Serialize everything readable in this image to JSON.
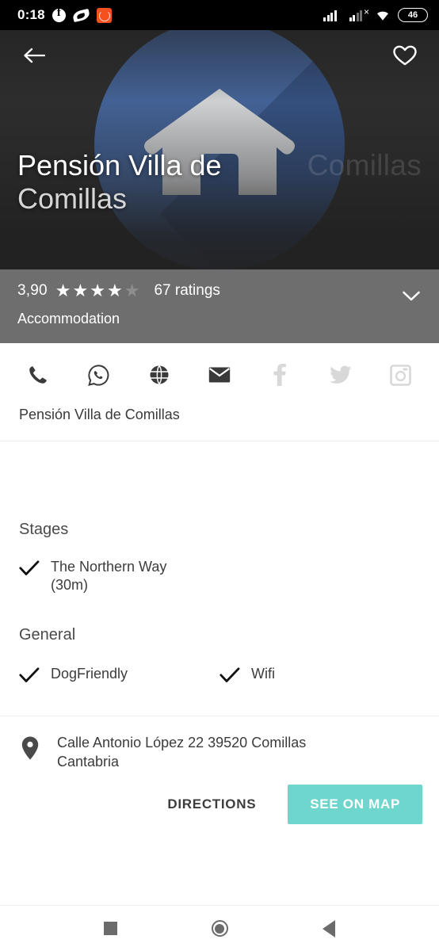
{
  "status_bar": {
    "time": "0:18",
    "battery_percent": "46",
    "icons": [
      "facebook-icon",
      "leaf-icon",
      "orange-app-icon",
      "signal-bars-icon",
      "signal-no-sim-icon",
      "wifi-icon",
      "battery-icon"
    ]
  },
  "hero": {
    "back_icon": "back-arrow-icon",
    "favorite_icon": "heart-outline-icon",
    "title_line1": "Pensión Villa de",
    "title_line2": "Comillas",
    "ghost_text": "Comillas",
    "placeholder_icon": "house-icon",
    "background_color": "#2f2f2f",
    "circle_color": "#4a6fac"
  },
  "rating": {
    "value": "3,90",
    "stars_filled": 4,
    "stars_total": 5,
    "count_label": "67 ratings",
    "category": "Accommodation",
    "expand_icon": "chevron-down-icon",
    "background_color": "#6e6e6e"
  },
  "actions": [
    {
      "name": "phone-icon",
      "enabled": true
    },
    {
      "name": "whatsapp-icon",
      "enabled": true
    },
    {
      "name": "website-globe-icon",
      "enabled": true
    },
    {
      "name": "email-icon",
      "enabled": true
    },
    {
      "name": "facebook-icon",
      "enabled": false
    },
    {
      "name": "twitter-icon",
      "enabled": false
    },
    {
      "name": "instagram-icon",
      "enabled": false
    }
  ],
  "contact": {
    "name": "Pensión Villa de Comillas"
  },
  "stages": {
    "title": "Stages",
    "items": [
      {
        "label": "The Northern Way\n(30m)",
        "line1": "The Northern Way",
        "line2": "(30m)",
        "checked": true
      }
    ]
  },
  "general": {
    "title": "General",
    "items": [
      {
        "label": "DogFriendly",
        "checked": true
      },
      {
        "label": "Wifi",
        "checked": true
      }
    ]
  },
  "address": {
    "pin_icon": "location-pin-icon",
    "line1": "Calle Antonio López 22 39520 Comillas",
    "line2": "Cantabria",
    "directions_label": "DIRECTIONS",
    "see_on_map_label": "SEE ON MAP",
    "see_on_map_color": "#6ed6cc"
  },
  "navbar": {
    "recents_icon": "square-recents-icon",
    "home_icon": "circle-home-icon",
    "back_icon": "triangle-back-icon"
  }
}
